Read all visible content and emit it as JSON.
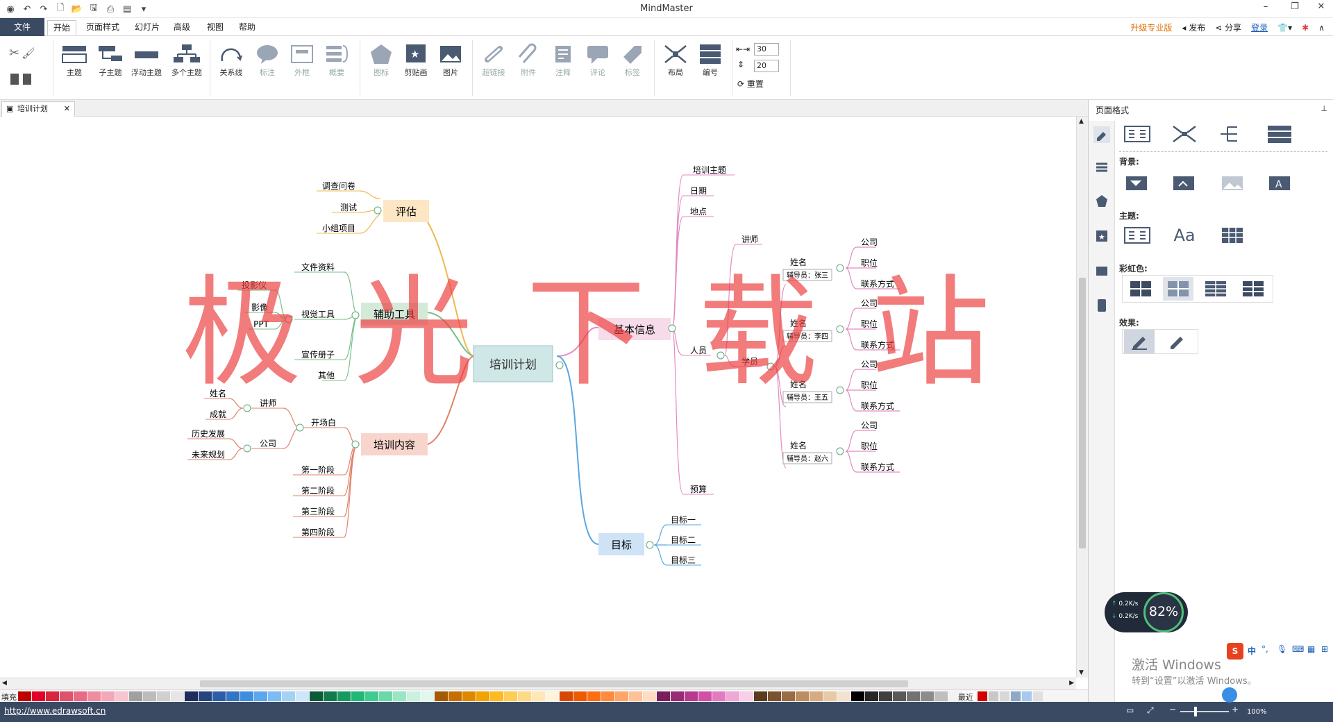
{
  "app": {
    "title": "MindMaster"
  },
  "menu": {
    "file": "文件",
    "home": "开始",
    "page_style": "页面样式",
    "slides": "幻灯片",
    "advanced": "高级",
    "view": "视图",
    "help": "帮助",
    "upgrade": "升级专业版",
    "publish": "发布",
    "share": "分享",
    "login": "登录"
  },
  "ribbon": {
    "topic": "主题",
    "subtopic": "子主题",
    "floating": "浮动主题",
    "multi": "多个主题",
    "relation": "关系线",
    "callout": "标注",
    "boundary": "外框",
    "summary": "概要",
    "icon": "图标",
    "clipart": "剪贴画",
    "picture": "图片",
    "hyperlink": "超链接",
    "attachment": "附件",
    "note": "注释",
    "comment": "评论",
    "tag": "标签",
    "layout": "布局",
    "numbering": "编号",
    "spacing_h": "30",
    "spacing_v": "20",
    "reset": "重置"
  },
  "doc_tab": {
    "label": "培训计划"
  },
  "side_panel": {
    "title": "页面格式",
    "background": "背景:",
    "theme": "主题:",
    "rainbow": "彩虹色:",
    "effect": "效果:",
    "font_sample": "Aa"
  },
  "mindmap": {
    "root": "培训计划",
    "evaluation": {
      "label": "评估",
      "children": [
        "调查问卷",
        "测试",
        "小组项目"
      ]
    },
    "tools": {
      "label": "辅助工具",
      "children": [
        "文件资料",
        "视觉工具",
        "宣传册子",
        "其他"
      ],
      "visual": [
        "投影仪",
        "影像",
        "PPT"
      ]
    },
    "content": {
      "label": "培训内容",
      "opening": "开场白",
      "stages": [
        "第一阶段",
        "第二阶段",
        "第三阶段",
        "第四阶段"
      ],
      "lecturer": "讲师",
      "lecturer_children": [
        "姓名",
        "成就"
      ],
      "company": "公司",
      "company_children": [
        "历史发展",
        "未来规划"
      ]
    },
    "basic": {
      "label": "基本信息",
      "children": [
        "培训主题",
        "日期",
        "地点"
      ],
      "people": "人员",
      "budget": "预算",
      "lecturer": "讲师",
      "students": "学员",
      "student_name": "姓名",
      "student_fields": [
        "公司",
        "职位",
        "联系方式"
      ],
      "tutors": [
        "辅导员：张三",
        "辅导员：李四",
        "辅导员：王五",
        "辅导员：赵六"
      ]
    },
    "goals": {
      "label": "目标",
      "children": [
        "目标一",
        "目标二",
        "目标三"
      ]
    }
  },
  "watermark": {
    "text": "极光下载站"
  },
  "net_widget": {
    "up": "0.2K/s",
    "down": "0.2K/s",
    "percent": "82%"
  },
  "activate": {
    "line1": "激活 Windows",
    "line2": "转到“设置”以激活 Windows。"
  },
  "ime": {
    "mode": "中"
  },
  "palette": {
    "fill_label": "填充",
    "recent_label": "最近",
    "colors": [
      "#c00000",
      "#e0002a",
      "#d7263d",
      "#e0526b",
      "#e86a85",
      "#f08ca0",
      "#f4a7b9",
      "#f7c4d0",
      "#a0a0a0",
      "#bcbcbc",
      "#d0d0d0",
      "#e6e6e6",
      "#1f2d5c",
      "#26457d",
      "#2b5ea7",
      "#3275c4",
      "#3e8ee0",
      "#5aa7ec",
      "#7bbcf2",
      "#a4d2f7",
      "#cde6fb",
      "#0b5a3a",
      "#127a4d",
      "#179a61",
      "#1fb877",
      "#3fcb8f",
      "#6ad9a9",
      "#9ae6c4",
      "#c8f2df",
      "#e0f8ec",
      "#a65a00",
      "#c66f00",
      "#e08700",
      "#f2a300",
      "#ffba21",
      "#ffcc55",
      "#ffda85",
      "#ffe8b4",
      "#fff3d9",
      "#d94800",
      "#ef5a00",
      "#ff6d12",
      "#ff8a3d",
      "#ffa568",
      "#ffc195",
      "#ffdcc2",
      "#7a1f5c",
      "#9a2a74",
      "#b83a8c",
      "#d150a7",
      "#e27bbf",
      "#ef a8d6",
      "#f7d0e8",
      "#5a3b1e",
      "#7a5230",
      "#9b6b43",
      "#bd8c60",
      "#d6ab82",
      "#e8c9a7",
      "#f3e2cf",
      "#000000",
      "#262626",
      "#404040",
      "#595959",
      "#737373",
      "#8c8c8c",
      "#bfbfbf",
      "#f2f2f2",
      "#ffffff"
    ],
    "recent": [
      "#d00000",
      "#c8c8c8",
      "#d8d8d8",
      "#8ea8c8",
      "#a8c8f0",
      "#e0e0e0"
    ]
  },
  "status": {
    "url": "http://www.edrawsoft.cn",
    "zoom": "100%"
  },
  "brand": {
    "text": "极光下载站"
  }
}
